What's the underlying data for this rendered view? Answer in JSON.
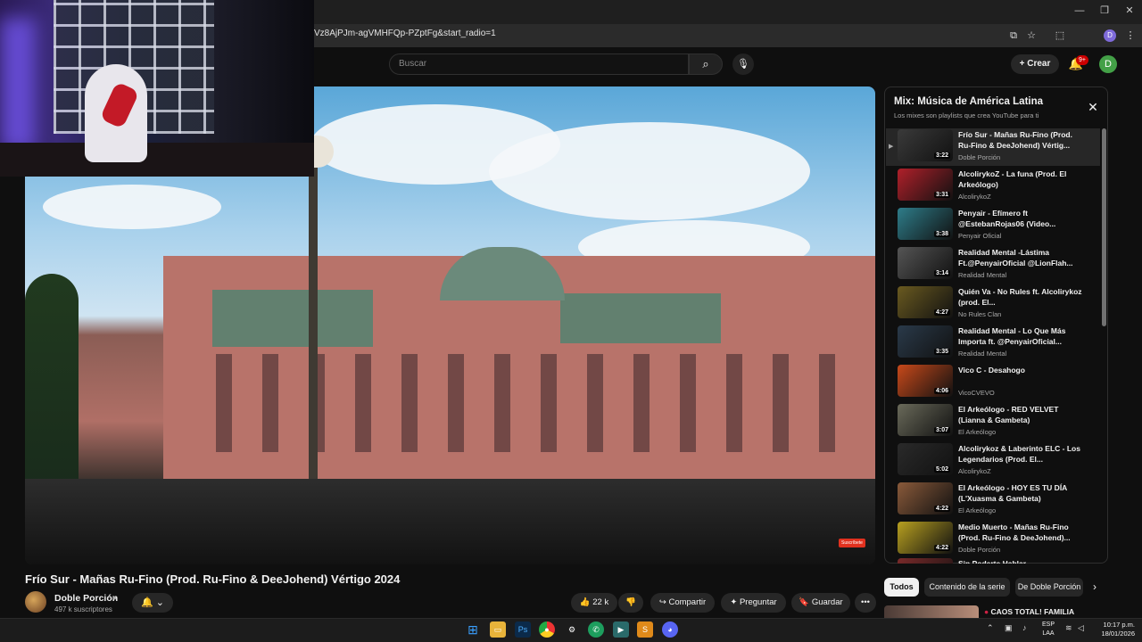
{
  "browser": {
    "url": "Vz8AjPJm-agVMHFQp-PZptFg&start_radio=1",
    "profile_initial": "D",
    "window_controls": [
      "—",
      "❐",
      "✕"
    ]
  },
  "header": {
    "search_placeholder": "Buscar",
    "create_label": "Crear",
    "notif_badge": "9+",
    "avatar_initial": "D"
  },
  "video": {
    "title": "Frío Sur - Mañas Ru-Fino (Prod. Ru-Fino & DeeJohend) Vértigo 2024",
    "channel": "Doble Porción",
    "subscribers": "497 k suscriptores",
    "likes": "22 k",
    "share_label": "Compartir",
    "ask_label": "Preguntar",
    "save_label": "Guardar",
    "subscribe_tag": "Suscríbete"
  },
  "playlist": {
    "title": "Mix: Música de América Latina",
    "subtitle": "Los mixes son playlists que crea YouTube para ti",
    "items": [
      {
        "title": "Frío Sur - Mañas Ru-Fino (Prod. Ru-Fino & DeeJohend) Vértig...",
        "channel": "Doble Porción",
        "duration": "3:22",
        "color": "#3a3a3a"
      },
      {
        "title": "AlcolirykoZ - La funa (Prod. El Arkeólogo)",
        "channel": "AlcolirykoZ",
        "duration": "3:31",
        "color": "#b0202a"
      },
      {
        "title": "Penyair - Efímero ft @EstebanRojas06 (Video...",
        "channel": "Penyair Oficial",
        "duration": "3:38",
        "color": "#2e7d8a"
      },
      {
        "title": "Realidad Mental -Lástima Ft.@PenyairOficial @LionFlah...",
        "channel": "Realidad Mental",
        "duration": "3:14",
        "color": "#555555"
      },
      {
        "title": "Quién Va - No Rules ft. Alcolirykoz (prod. El...",
        "channel": "No Rules Clan",
        "duration": "4:27",
        "color": "#6a5a20"
      },
      {
        "title": "Realidad Mental - Lo Que Más Importa ft. @PenyairOficial...",
        "channel": "Realidad Mental",
        "duration": "3:35",
        "color": "#2a3a4a"
      },
      {
        "title": "Vico C - Desahogo",
        "channel": "VicoCVEVO",
        "duration": "4:06",
        "color": "#c8491a"
      },
      {
        "title": "El Arkeólogo - RED VELVET (Lianna & Gambeta)",
        "channel": "El Arkeólogo",
        "duration": "3:07",
        "color": "#6a6a5a"
      },
      {
        "title": "Alcolirykoz & Laberinto ELC - Los Legendarios (Prod. El...",
        "channel": "AlcolirykoZ",
        "duration": "5:02",
        "color": "#2a2a2a"
      },
      {
        "title": "El Arkeólogo - HOY ES TU DÍA (L'Xuasma & Gambeta)",
        "channel": "El Arkeólogo",
        "duration": "4:22",
        "color": "#8a5a3a"
      },
      {
        "title": "Medio Muerto - Mañas Ru-Fino (Prod. Ru-Fino & DeeJohend)...",
        "channel": "Doble Porción",
        "duration": "4:22",
        "color": "#b8a020"
      },
      {
        "title": "Sin Poderte Hablar",
        "channel": "",
        "duration": "",
        "color": "#7a2a2a"
      }
    ]
  },
  "chips": [
    "Todos",
    "Contenido de la serie",
    "De Doble Porción"
  ],
  "recommendation": {
    "title": "CAOS TOTAL! FAMILIA"
  },
  "taskbar": {
    "lang_top": "ESP",
    "lang_bottom": "LAA",
    "time": "10:17 p.m.",
    "date": "18/01/2026"
  }
}
